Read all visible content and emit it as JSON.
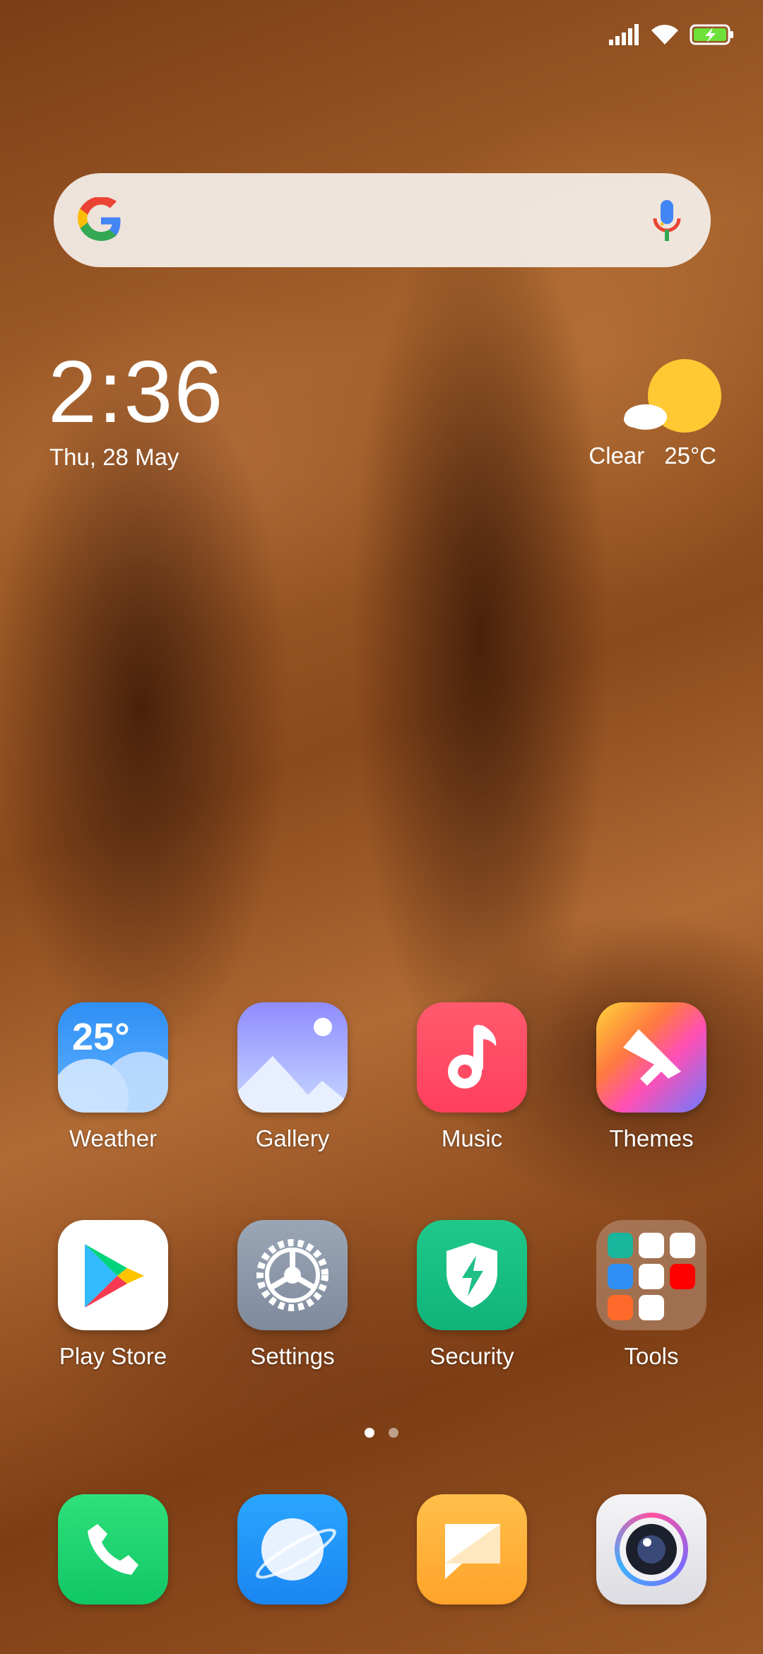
{
  "status_bar": {
    "icons": [
      "signal-icon",
      "wifi-icon",
      "battery-charging-icon"
    ]
  },
  "search": {
    "logo": "google-g-icon",
    "mic": "mic-icon"
  },
  "clock": {
    "time": "2:36",
    "date": "Thu, 28 May"
  },
  "weather": {
    "condition": "Clear",
    "temperature": "25°C",
    "icon": "sun-cloud-icon"
  },
  "apps": [
    {
      "label": "Weather",
      "icon_text": "25°"
    },
    {
      "label": "Gallery"
    },
    {
      "label": "Music"
    },
    {
      "label": "Themes"
    },
    {
      "label": "Play Store"
    },
    {
      "label": "Settings"
    },
    {
      "label": "Security"
    },
    {
      "label": "Tools"
    }
  ],
  "pager": {
    "pages": 2,
    "active": 1
  },
  "dock": [
    "phone-icon",
    "browser-icon",
    "messages-icon",
    "camera-icon"
  ]
}
